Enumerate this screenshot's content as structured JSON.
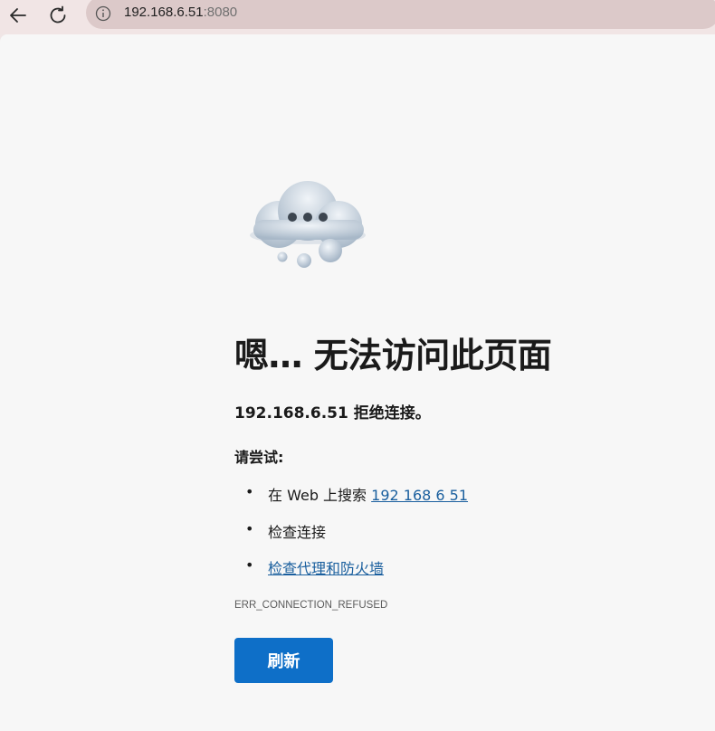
{
  "browser": {
    "url_host": "192.168.6.51",
    "url_port": ":8080",
    "back_icon": "arrow-left-icon",
    "refresh_icon": "refresh-icon",
    "info_icon": "info-icon"
  },
  "error": {
    "heading": "嗯… 无法访问此页面",
    "message": "192.168.6.51 拒绝连接。",
    "try_label": "请尝试:",
    "suggestions": {
      "search_prefix": "在 Web 上搜索 ",
      "search_link": "192 168 6 51",
      "check_connection": "检查连接",
      "check_proxy": "检查代理和防火墙"
    },
    "code": "ERR_CONNECTION_REFUSED",
    "refresh_button": "刷新",
    "bullet": "•"
  },
  "colors": {
    "accent": "#0e6fc8",
    "link": "#1a5f9e",
    "toolbar": "#f1e5e5",
    "page_background": "#f7f7f7"
  }
}
